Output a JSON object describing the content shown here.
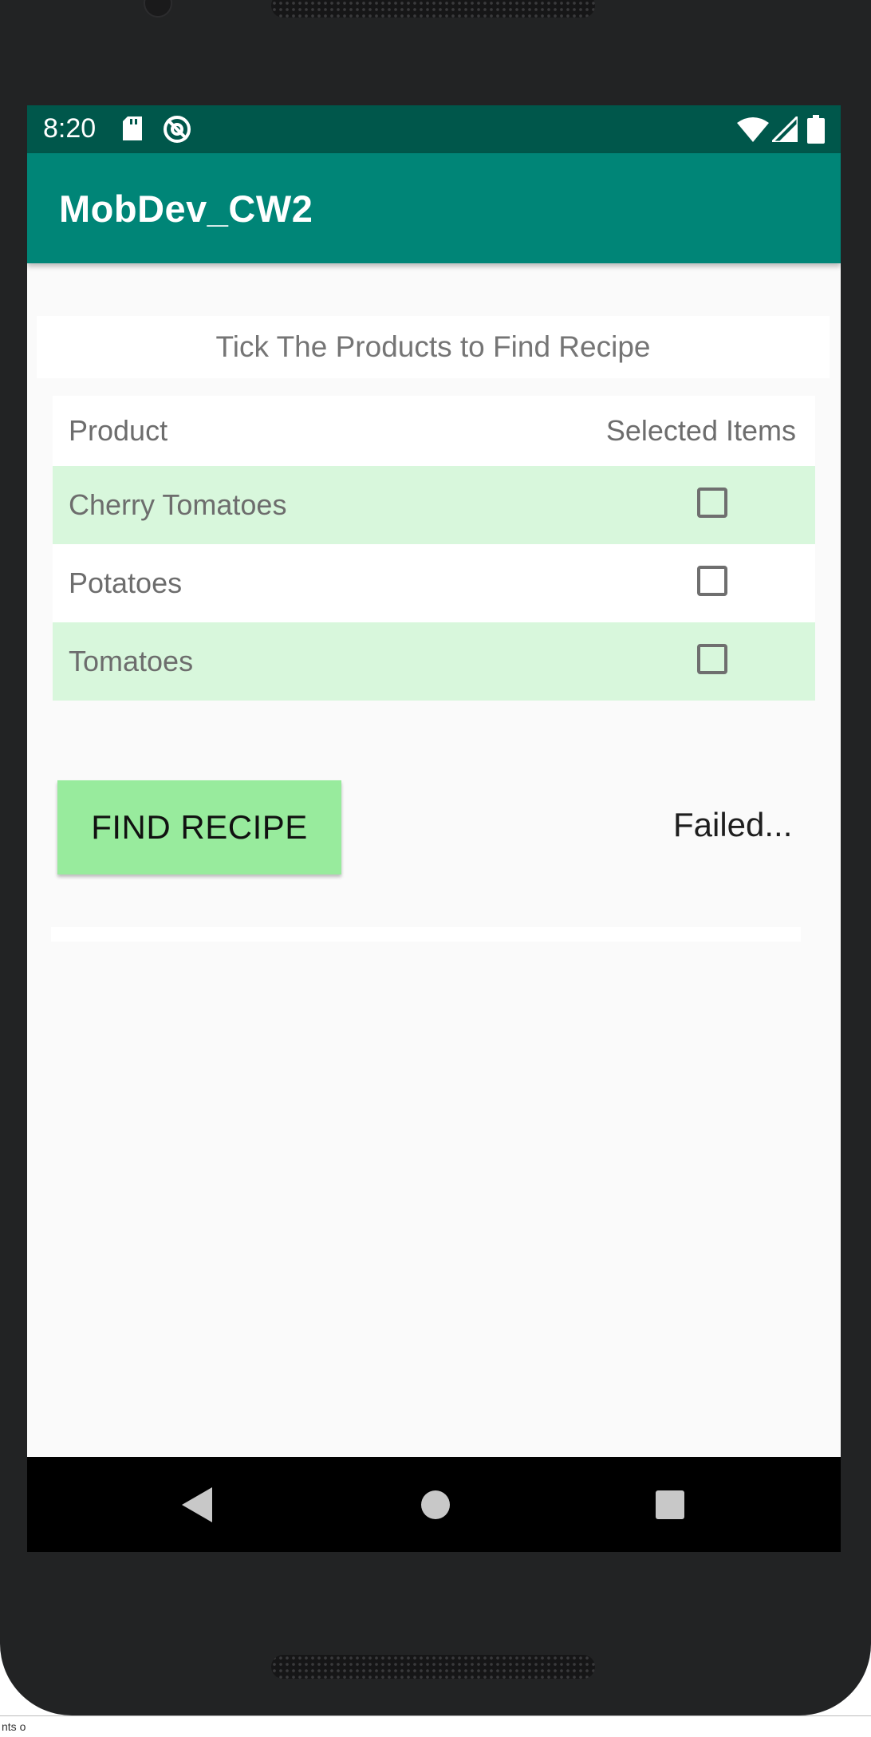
{
  "status_bar": {
    "time": "8:20",
    "icons": [
      "sd-card-icon",
      "sync-disabled-icon",
      "wifi-icon",
      "cell-signal-icon",
      "battery-icon"
    ],
    "background": "#00574b"
  },
  "app_bar": {
    "title": "MobDev_CW2",
    "background": "#008577"
  },
  "instructions": "Tick The Products to Find Recipe",
  "table": {
    "columns": [
      "Product",
      "Selected Items"
    ],
    "rows": [
      {
        "product": "Cherry Tomatoes",
        "checked": false
      },
      {
        "product": "Potatoes",
        "checked": false
      },
      {
        "product": "Tomatoes",
        "checked": false
      }
    ],
    "row_tint": "#d8f7dc"
  },
  "find_button": {
    "label": "FIND RECIPE",
    "color": "#98eb9d"
  },
  "status_text": "Failed...",
  "nav_bar": {
    "buttons": [
      "back-icon",
      "home-icon",
      "recents-icon"
    ]
  },
  "bottom_strip": "nts o"
}
